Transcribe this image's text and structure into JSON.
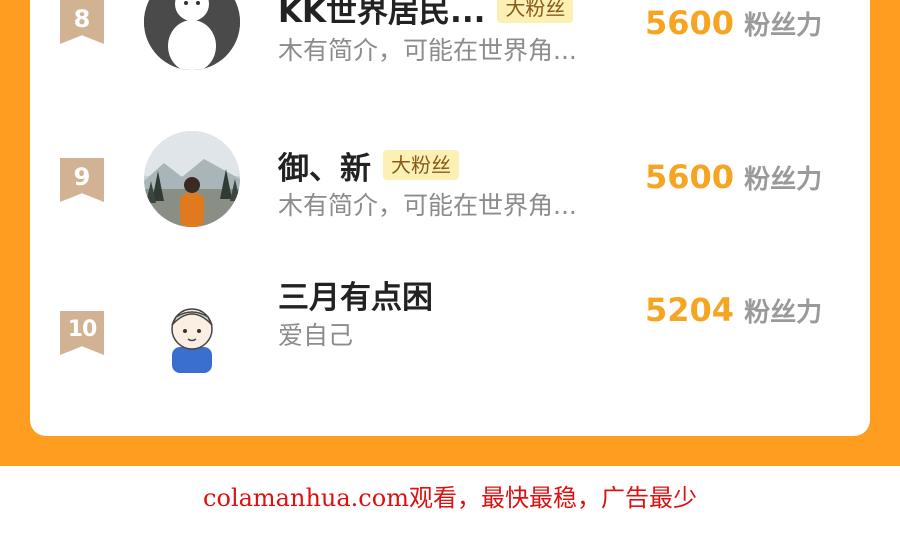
{
  "ranking": {
    "items": [
      {
        "rank": "8",
        "name": "KK世界居民...",
        "badge": "大粉丝",
        "description": "木有简介，可能在世界角...",
        "score": "5600",
        "score_unit": "粉丝力",
        "avatar_icon": "ghost-avatar-icon"
      },
      {
        "rank": "9",
        "name": "御、新",
        "badge": "大粉丝",
        "description": "木有简介，可能在世界角...",
        "score": "5600",
        "score_unit": "粉丝力",
        "avatar_icon": "landscape-photo-avatar"
      },
      {
        "rank": "10",
        "name": "三月有点困",
        "description": "爱自己",
        "score": "5204",
        "score_unit": "粉丝力",
        "avatar_icon": "cartoon-person-avatar"
      }
    ]
  },
  "footer": {
    "watermark": "colamanhua.com观看，最快最稳，广告最少"
  },
  "colors": {
    "accent_orange": "#ff9d20",
    "score_color": "#f5a521",
    "rank_badge": "#d1b292",
    "watermark_red": "#e01010"
  }
}
